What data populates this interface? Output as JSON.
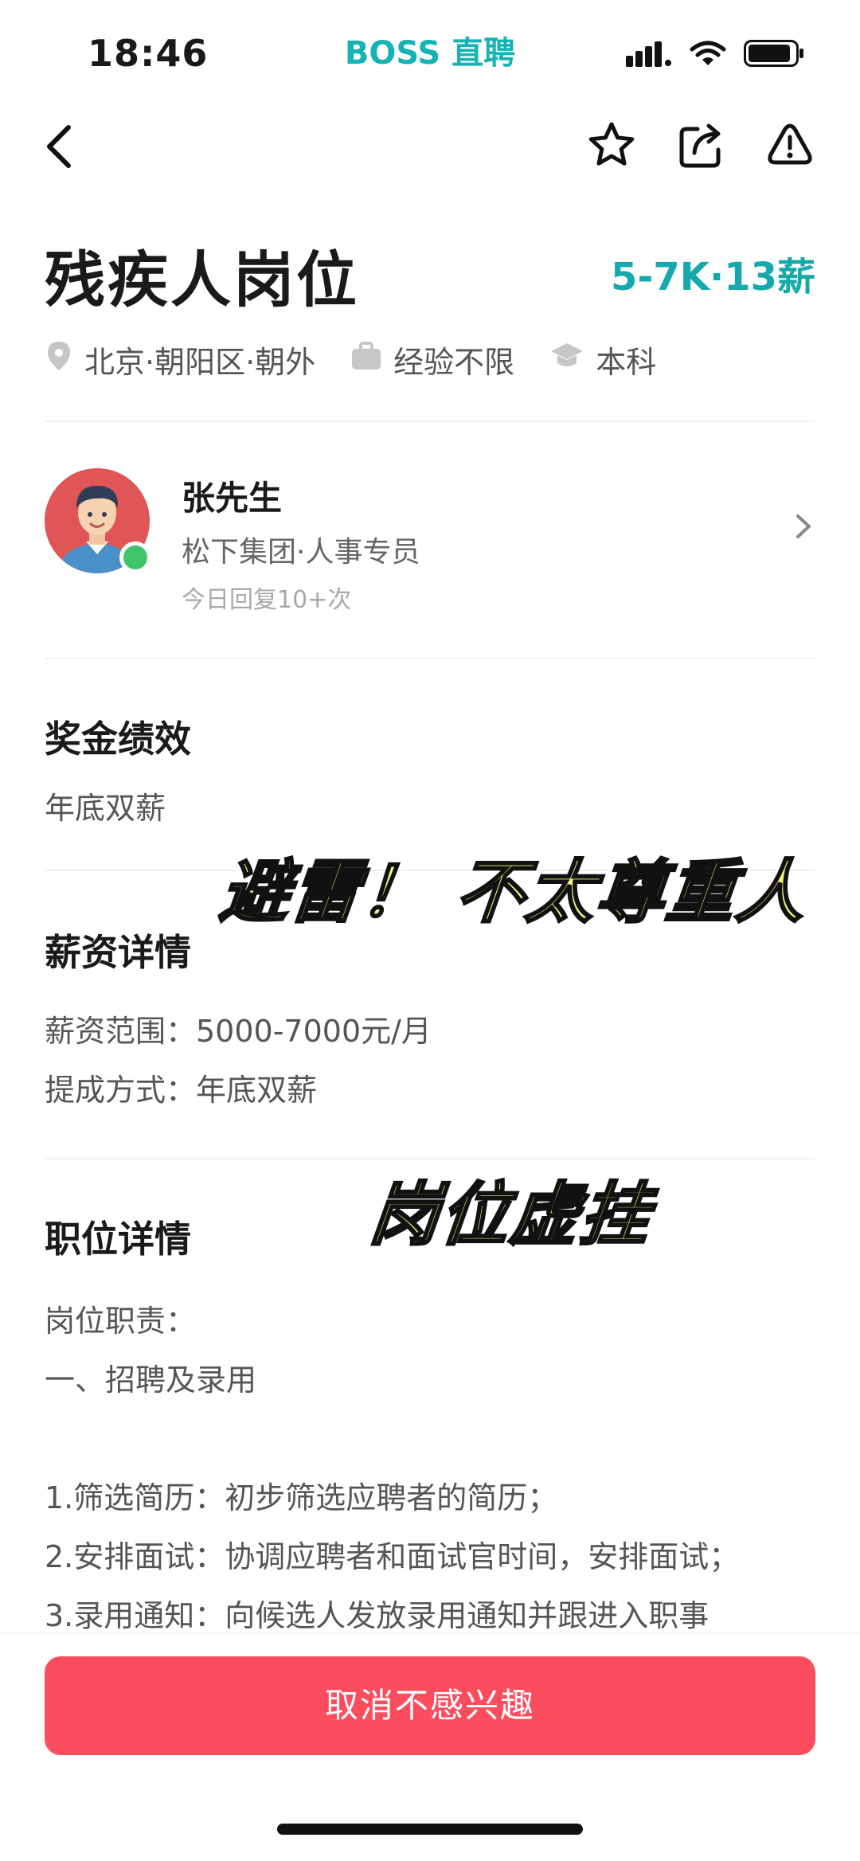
{
  "status_bar": {
    "time": "18:46",
    "app_brand": "BOSS 直聘",
    "icons": [
      "signal-icon",
      "wifi-icon",
      "battery-icon"
    ]
  },
  "nav": {
    "icons": [
      "back-icon",
      "star-icon",
      "share-icon",
      "report-icon"
    ]
  },
  "job": {
    "title": "残疾人岗位",
    "salary": "5-7K·13薪",
    "tags": [
      {
        "icon": "location-icon",
        "label": "北京·朝阳区·朝外"
      },
      {
        "icon": "briefcase-icon",
        "label": "经验不限"
      },
      {
        "icon": "graduation-icon",
        "label": "本科"
      }
    ]
  },
  "recruiter": {
    "name": "张先生",
    "company": "松下集团·人事专员",
    "reply": "今日回复10+次"
  },
  "sections": {
    "bonus": {
      "title": "奖金绩效",
      "text": "年底双薪"
    },
    "salary": {
      "title": "薪资详情",
      "lines": [
        "薪资范围：5000-7000元/月",
        "提成方式：年底双薪"
      ]
    },
    "position": {
      "title": "职位详情",
      "lines": [
        "岗位职责：",
        "一、招聘及录用",
        "1.筛选简历：初步筛选应聘者的简历；",
        "2.安排面试：协调应聘者和面试官时间，安排面试；",
        "3.录用通知：向候选人发放录用通知并跟进入职事"
      ]
    }
  },
  "overlays": {
    "warning": "避雷！ 不太尊重人",
    "fake": "岗位虚挂"
  },
  "actions": {
    "primary": "取消不感兴趣"
  },
  "colors": {
    "brand": "#15b3b3",
    "salary": "#16a9ac",
    "cta": "#fc4d5e",
    "online": "#3fc46a",
    "overlay_fill": "#f2f57a"
  }
}
